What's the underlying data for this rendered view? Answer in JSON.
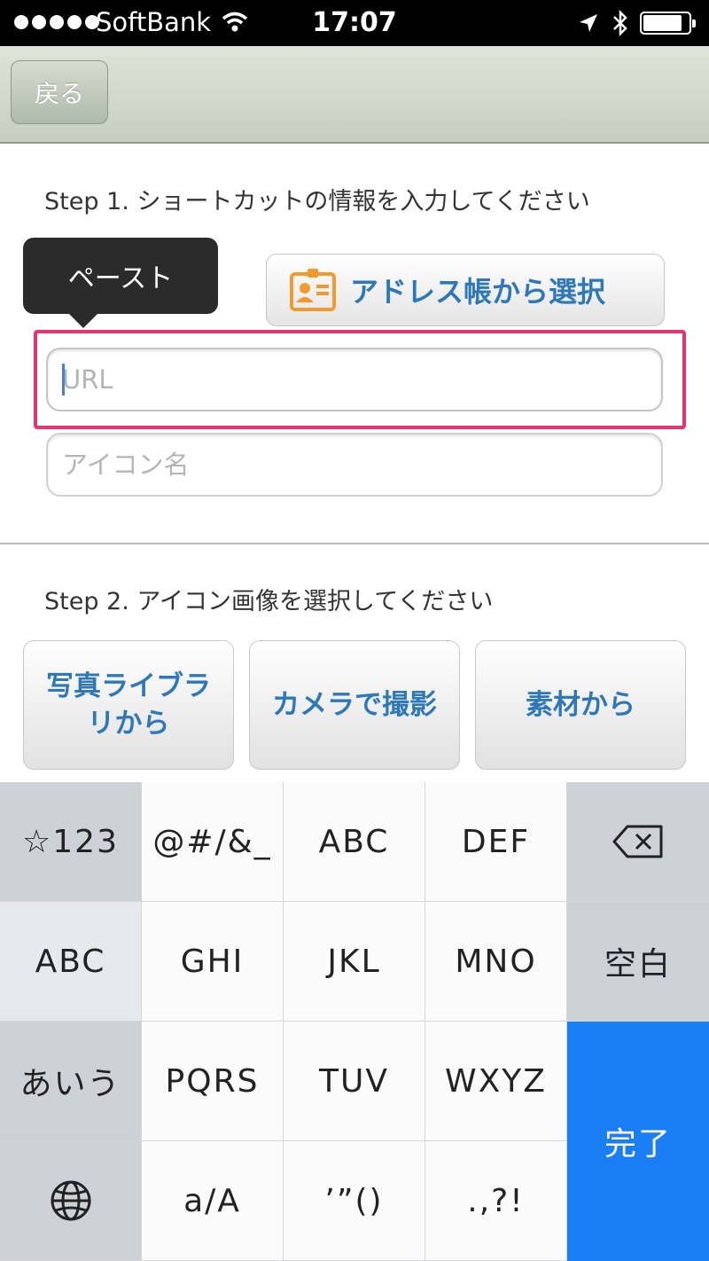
{
  "status_bar": {
    "carrier": "SoftBank",
    "time": "17:07",
    "battery_level": 0.85
  },
  "nav": {
    "back_label": "戻る"
  },
  "step1": {
    "label": "Step 1. ショートカットの情報を入力してください",
    "paste_tooltip": "ペースト",
    "address_book_button": "アドレス帳から選択",
    "url_placeholder": "URL",
    "icon_name_placeholder": "アイコン名"
  },
  "step2": {
    "label": "Step 2. アイコン画像を選択してください",
    "photo_library_button": "写真ライブラリから",
    "camera_button": "カメラで撮影",
    "material_button": "素材から"
  },
  "keyboard": {
    "rows": [
      [
        "☆123",
        "@#/&_",
        "ABC",
        "DEF"
      ],
      [
        "ABC",
        "GHI",
        "JKL",
        "MNO",
        "空白"
      ],
      [
        "あいう",
        "PQRS",
        "TUV",
        "WXYZ"
      ],
      [
        "a/A",
        "’”()",
        ".,?!"
      ]
    ],
    "done_label": "完了",
    "space_label": "空白"
  },
  "colors": {
    "accent_blue": "#2e78b8",
    "highlight_pink": "#e8356f",
    "done_key": "#1a7ef6"
  },
  "icons": [
    "wifi-icon",
    "location-icon",
    "bluetooth-icon",
    "battery-icon",
    "address-card-icon",
    "backspace-icon",
    "globe-icon"
  ]
}
